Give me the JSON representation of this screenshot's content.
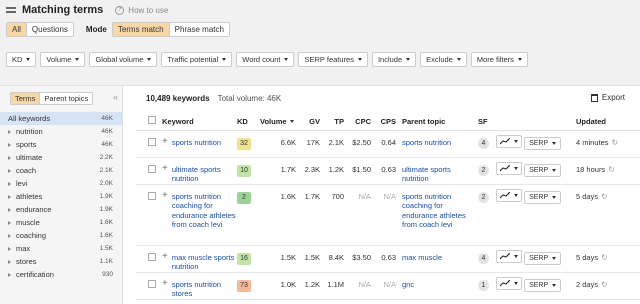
{
  "header": {
    "title": "Matching terms",
    "help_label": "How to use"
  },
  "scope_tabs": [
    "All",
    "Questions"
  ],
  "mode": {
    "label": "Mode",
    "options": [
      "Terms match",
      "Phrase match"
    ]
  },
  "filters": [
    "KD",
    "Volume",
    "Global volume",
    "Traffic potential",
    "Word count",
    "SERP features",
    "Include",
    "Exclude",
    "More filters"
  ],
  "sidebar": {
    "tabs": [
      "Terms",
      "Parent topics"
    ],
    "collapse_icon": "«",
    "items": [
      {
        "name": "All keywords",
        "count": "46K"
      },
      {
        "name": "nutrition",
        "count": "46K"
      },
      {
        "name": "sports",
        "count": "46K"
      },
      {
        "name": "ultimate",
        "count": "2.2K"
      },
      {
        "name": "coach",
        "count": "2.1K"
      },
      {
        "name": "levi",
        "count": "2.0K"
      },
      {
        "name": "athletes",
        "count": "1.9K"
      },
      {
        "name": "endurance",
        "count": "1.9K"
      },
      {
        "name": "muscle",
        "count": "1.6K"
      },
      {
        "name": "coaching",
        "count": "1.6K"
      },
      {
        "name": "max",
        "count": "1.5K"
      },
      {
        "name": "stores",
        "count": "1.1K"
      },
      {
        "name": "certification",
        "count": "930"
      }
    ]
  },
  "summary": {
    "keywords": "10,489 keywords",
    "total_volume": "Total volume: 46K"
  },
  "export_label": "Export",
  "columns": [
    "Keyword",
    "KD",
    "Volume",
    "GV",
    "TP",
    "CPC",
    "CPS",
    "Parent topic",
    "SF",
    "Updated"
  ],
  "rows": [
    {
      "keyword": "sports nutrition",
      "kd": "32",
      "kd_color": "#efe38e",
      "volume": "6.6K",
      "gv": "17K",
      "tp": "2.1K",
      "cpc": "$2.50",
      "cps": "0.64",
      "parent": "sports nutrition",
      "sf": "4",
      "serp": "SERP",
      "updated": "4 minutes"
    },
    {
      "keyword": "ultimate sports nutrition",
      "kd": "10",
      "kd_color": "#c2e3a5",
      "volume": "1.7K",
      "gv": "2.3K",
      "tp": "1.2K",
      "cpc": "$1.50",
      "cps": "0.63",
      "parent": "ultimate sports nutrition",
      "sf": "2",
      "serp": "SERP",
      "updated": "18 hours"
    },
    {
      "keyword": "sports nutrition coaching for endurance athletes from coach levi",
      "kd": "2",
      "kd_color": "#9fd29a",
      "volume": "1.6K",
      "gv": "1.7K",
      "tp": "700",
      "cpc": "N/A",
      "cps": "N/A",
      "parent": "sports nutrition coaching for endurance athletes from coach levi",
      "sf": "2",
      "serp": "SERP",
      "updated": "5 days"
    },
    {
      "keyword": "max muscle sports nutrition",
      "kd": "16",
      "kd_color": "#c2e3a5",
      "volume": "1.5K",
      "gv": "1.5K",
      "tp": "8.4K",
      "cpc": "$3.50",
      "cps": "0.63",
      "parent": "max muscle",
      "sf": "4",
      "serp": "SERP",
      "updated": "5 days"
    },
    {
      "keyword": "sports nutrition stores",
      "kd": "73",
      "kd_color": "#f4b89a",
      "volume": "1.0K",
      "gv": "1.2K",
      "tp": "1.1M",
      "cpc": "N/A",
      "cps": "N/A",
      "parent": "gnc",
      "sf": "1",
      "serp": "SERP",
      "updated": "2 days"
    }
  ]
}
